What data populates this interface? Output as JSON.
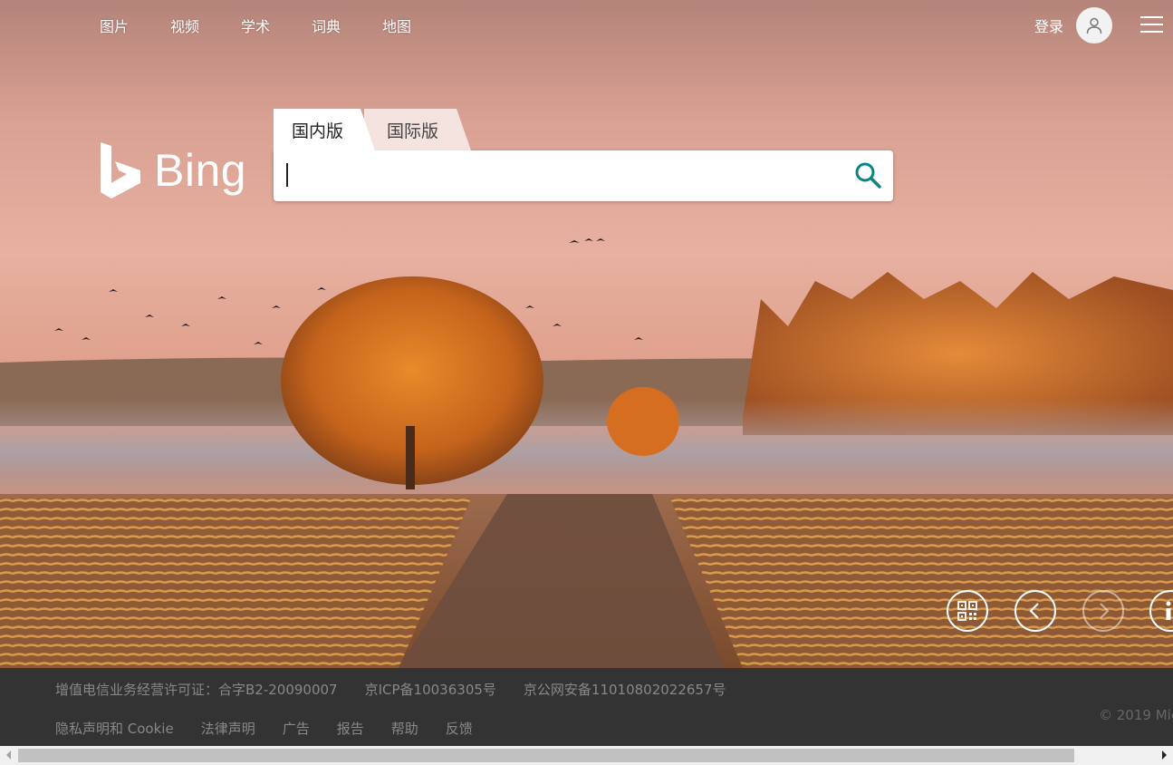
{
  "nav": {
    "items": [
      {
        "label": "图片"
      },
      {
        "label": "视频"
      },
      {
        "label": "学术"
      },
      {
        "label": "词典"
      },
      {
        "label": "地图"
      }
    ],
    "login_label": "登录"
  },
  "logo": {
    "text": "Bing"
  },
  "search": {
    "tab_active": "国内版",
    "tab_inactive": "国际版",
    "value": "",
    "placeholder": ""
  },
  "controls": {
    "icons": [
      "qr-code-icon",
      "previous-image-icon",
      "next-image-icon",
      "info-icon"
    ]
  },
  "footer": {
    "license_items": [
      "增值电信业务经营许可证：合字B2-20090007",
      "京ICP备10036305号",
      "京公网安备11010802022657号"
    ],
    "links": [
      "隐私声明和 Cookie",
      "法律声明",
      "广告",
      "报告",
      "帮助",
      "反馈"
    ],
    "copyright": "© 2019 Mic"
  },
  "colors": {
    "accent": "#0c8484",
    "footer_bg": "#333333",
    "footer_text": "#888888"
  }
}
